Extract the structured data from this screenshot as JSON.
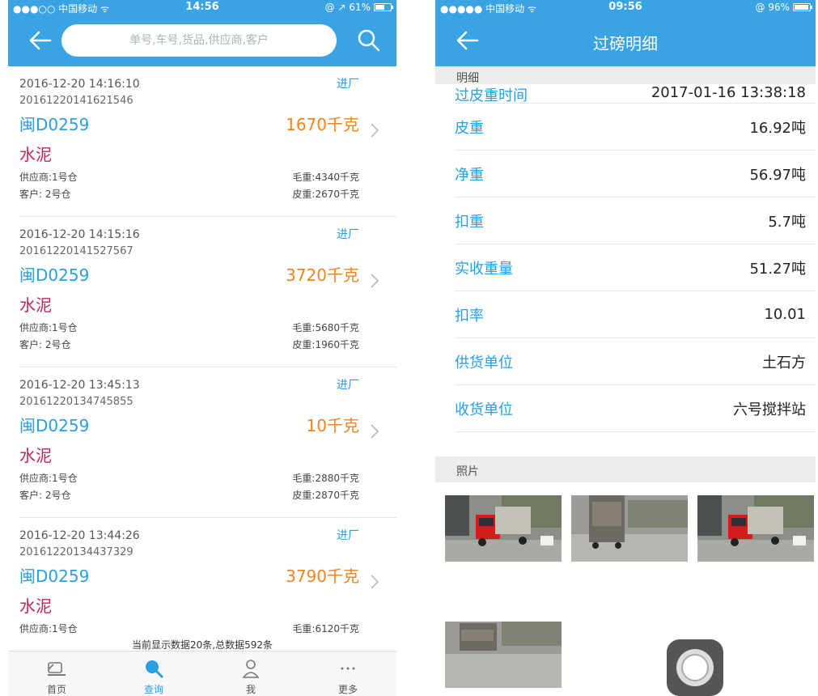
{
  "colors": {
    "accent": "#3aa3e3",
    "link": "#2a9fe0",
    "weight": "#f0831e",
    "goods": "#c0235d"
  },
  "left": {
    "status": {
      "carrier": "●●●○○ 中国移动 ᯤ",
      "time": "14:56",
      "battery": "@ ↗ 61%",
      "battery_level": 0.61
    },
    "search": {
      "placeholder": "单号,车号,货品,供应商,客户"
    },
    "records": [
      {
        "time": "2016-12-20 14:16:10",
        "status": "进厂",
        "id": "20161220141621546",
        "plate": "闽D0259",
        "net": "1670千克",
        "goods": "水泥",
        "supplier": "供应商:1号仓",
        "gross": "毛重:4340千克",
        "customer": "客户:  2号仓",
        "tare": "皮重:2670千克"
      },
      {
        "time": "2016-12-20 14:15:16",
        "status": "进厂",
        "id": "20161220141527567",
        "plate": "闽D0259",
        "net": "3720千克",
        "goods": "水泥",
        "supplier": "供应商:1号仓",
        "gross": "毛重:5680千克",
        "customer": "客户:  2号仓",
        "tare": "皮重:1960千克"
      },
      {
        "time": "2016-12-20 13:45:13",
        "status": "进厂",
        "id": "20161220134745855",
        "plate": "闽D0259",
        "net": "10千克",
        "goods": "水泥",
        "supplier": "供应商:1号仓",
        "gross": "毛重:2880千克",
        "customer": "客户:  2号仓",
        "tare": "皮重:2870千克"
      },
      {
        "time": "2016-12-20 13:44:26",
        "status": "进厂",
        "id": "20161220134437329",
        "plate": "闽D0259",
        "net": "3790千克",
        "goods": "水泥",
        "supplier": "供应商:1号仓",
        "gross": "毛重:6120千克",
        "customer": "",
        "tare": ""
      }
    ],
    "footer_count": "当前显示数据20条,总数据592条",
    "tabs": [
      {
        "label": "首页",
        "icon": "truck-icon"
      },
      {
        "label": "查询",
        "icon": "search-icon"
      },
      {
        "label": "我",
        "icon": "person-icon"
      },
      {
        "label": "更多",
        "icon": "more-icon"
      }
    ]
  },
  "right": {
    "status": {
      "carrier": "●●●●● 中国移动 ᯤ",
      "time": "09:56",
      "battery": "@ 96%",
      "battery_level": 0.96
    },
    "title": "过磅明细",
    "details_header": "明细",
    "details": [
      {
        "label": "过皮重时间",
        "value": "2017-01-16 13:38:18"
      },
      {
        "label": "皮重",
        "value": "16.92吨"
      },
      {
        "label": "净重",
        "value": "56.97吨"
      },
      {
        "label": "扣重",
        "value": "5.7吨"
      },
      {
        "label": "实收重量",
        "value": "51.27吨"
      },
      {
        "label": "扣率",
        "value": "10.01"
      },
      {
        "label": "供货单位",
        "value": "土石方"
      },
      {
        "label": "收货单位",
        "value": "六号搅拌站"
      }
    ],
    "photos_header": "照片"
  }
}
